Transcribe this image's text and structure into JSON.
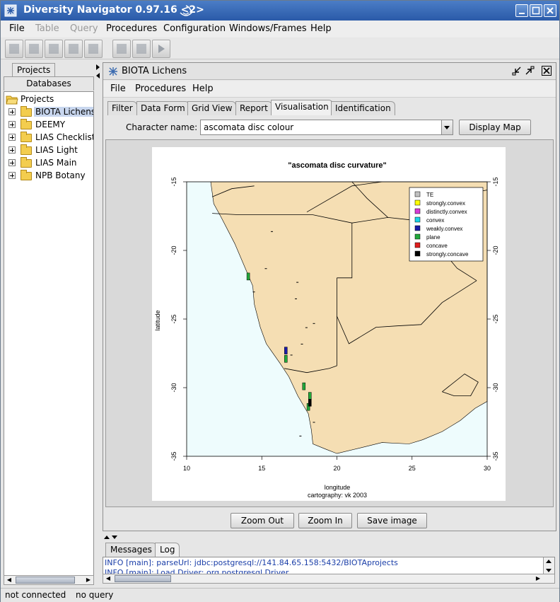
{
  "window": {
    "title": "Diversity Navigator 0.97.16 <2>"
  },
  "menubar": {
    "items": [
      "File",
      "Table",
      "Query",
      "Procedures",
      "Configuration",
      "Windows/Frames",
      "Help"
    ],
    "disabled": [
      "Table",
      "Query"
    ]
  },
  "left_panel": {
    "tabs": [
      "Projects",
      "Databases"
    ],
    "tree_root": "Projects",
    "tree_items": [
      "BIOTA Lichens",
      "DEEMY",
      "LIAS Checklists",
      "LIAS Light",
      "LIAS Main",
      "NPB Botany"
    ],
    "selected": "BIOTA Lichens"
  },
  "internal_frame": {
    "title": "BIOTA Lichens",
    "menu": [
      "File",
      "Procedures",
      "Help"
    ],
    "tabs": [
      "Filter",
      "Data Form",
      "Grid View",
      "Report",
      "Visualisation",
      "Identification"
    ],
    "active_tab": "Visualisation",
    "character_label": "Character name:",
    "character_value": "ascomata disc colour",
    "display_map_button": "Display Map",
    "zoom_out_button": "Zoom Out",
    "zoom_in_button": "Zoom In",
    "save_image_button": "Save image"
  },
  "chart_data": {
    "type": "scatter",
    "title": "\"ascomata disc curvature\"",
    "xlabel": "longitude",
    "ylabel": "latitude",
    "caption": "cartography: vk 2003",
    "xlim": [
      10,
      30
    ],
    "ylim": [
      -35,
      -15
    ],
    "x_ticks": [
      "10",
      "15",
      "20",
      "25",
      "30"
    ],
    "y_ticks": [
      "-15",
      "-20",
      "-25",
      "-30",
      "-35"
    ],
    "legend_position": "top-right",
    "legend": [
      {
        "label": "TE",
        "color": "#c0c0c0"
      },
      {
        "label": "strongly.convex",
        "color": "#ffff00"
      },
      {
        "label": "distinctly.convex",
        "color": "#d63bd6"
      },
      {
        "label": "convex",
        "color": "#19d3e6"
      },
      {
        "label": "weakly.convex",
        "color": "#1a1aa8"
      },
      {
        "label": "plane",
        "color": "#22a83a"
      },
      {
        "label": "concave",
        "color": "#e01e1e"
      },
      {
        "label": "strongly.concave",
        "color": "#000000"
      }
    ],
    "points": [
      {
        "lon": 14.1,
        "lat": -21.9,
        "category": "plane"
      },
      {
        "lon": 16.6,
        "lat": -27.9,
        "category": "plane"
      },
      {
        "lon": 16.6,
        "lat": -27.3,
        "category": "weakly.convex"
      },
      {
        "lon": 17.8,
        "lat": -29.9,
        "category": "plane"
      },
      {
        "lon": 18.1,
        "lat": -31.4,
        "category": "plane"
      },
      {
        "lon": 18.2,
        "lat": -30.6,
        "category": "plane"
      },
      {
        "lon": 18.2,
        "lat": -31.1,
        "category": "strongly.concave"
      }
    ],
    "colors": {
      "ocean": "#eefcfd",
      "land": "#f5deb3",
      "border": "#000000"
    }
  },
  "messages": {
    "tabs": [
      "Messages",
      "Log"
    ],
    "active_tab": "Log",
    "lines": [
      "INFO    [main]:  parseUrl: jdbc:postgresql://141.84.65.158:5432/BIOTAprojects",
      "INFO    [main]:  Load Driver: org.postgresql.Driver"
    ]
  },
  "status": {
    "connection": "not connected",
    "query": "no query"
  }
}
